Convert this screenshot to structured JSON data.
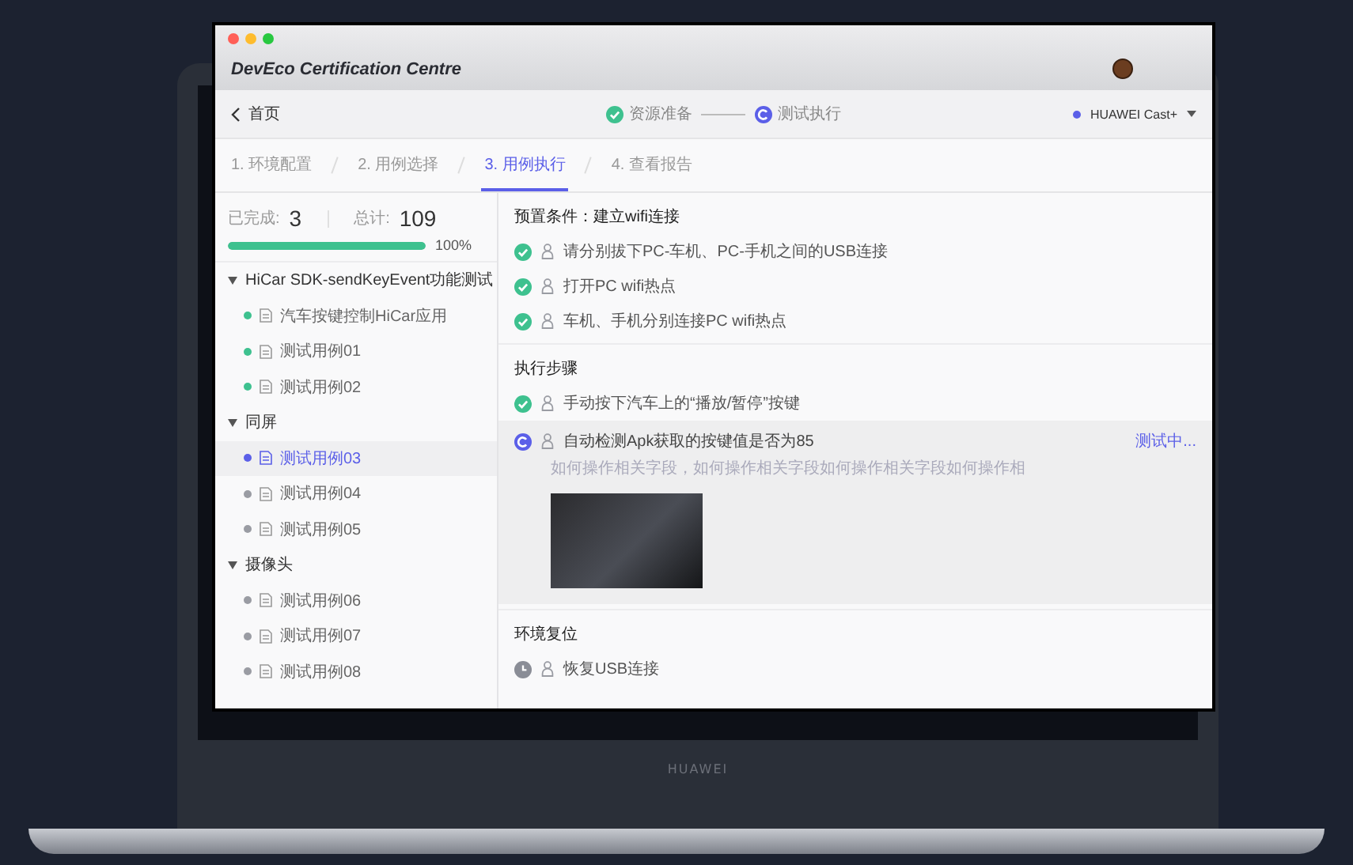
{
  "window": {
    "title": "DevEco Certification Centre"
  },
  "nav": {
    "back_label": "首页",
    "stepper": [
      {
        "label": "资源准备",
        "done": true
      },
      {
        "label": "测试执行",
        "done": false,
        "running": true
      }
    ],
    "device": {
      "name": "HUAWEI Cast+",
      "color": "#5b5fe8"
    }
  },
  "tabs": [
    {
      "label": "1. 环境配置",
      "selected": false
    },
    {
      "label": "2. 用例选择",
      "selected": false
    },
    {
      "label": "3. 用例执行",
      "selected": true
    },
    {
      "label": "4. 查看报告",
      "selected": false
    }
  ],
  "summary": {
    "completed_label": "已完成:",
    "completed": "3",
    "total_label": "总计:",
    "total": "109",
    "level": 1,
    "percent": "100%"
  },
  "tree": [
    {
      "label": "HiCar SDK-sendKeyEvent功能测试",
      "expanded": true,
      "children": [
        {
          "label": "汽车按键控制HiCar应用",
          "color": "#3ec18f",
          "selected": false
        },
        {
          "label": "测试用例01",
          "color": "#3ec18f",
          "selected": false
        },
        {
          "label": "测试用例02",
          "color": "#3ec18f",
          "selected": false
        }
      ]
    },
    {
      "label": "同屏",
      "expanded": true,
      "children": [
        {
          "label": "测试用例03",
          "color": "#5b5fe8",
          "selected": true
        },
        {
          "label": "测试用例04",
          "color": "#9a9ca3",
          "selected": false
        },
        {
          "label": "测试用例05",
          "color": "#9a9ca3",
          "selected": false
        }
      ]
    },
    {
      "label": "摄像头",
      "expanded": true,
      "children": [
        {
          "label": "测试用例06",
          "color": "#9a9ca3",
          "selected": false
        },
        {
          "label": "测试用例07",
          "color": "#9a9ca3",
          "selected": false
        },
        {
          "label": "测试用例08",
          "color": "#9a9ca3",
          "selected": false
        }
      ]
    }
  ],
  "sections": [
    {
      "title": "预置条件：建立wifi连接",
      "items": [
        {
          "text": "请分别拔下PC-车机、PC-手机之间的USB连接",
          "done": true,
          "kind": "step"
        },
        {
          "text": "打开PC wifi热点",
          "done": true,
          "kind": "step"
        },
        {
          "text": "车机、手机分别连接PC wifi热点",
          "done": true,
          "kind": "step"
        }
      ]
    },
    {
      "title": "执行步骤",
      "items": [
        {
          "text": "手动按下汽车上的“播放/暂停”按键",
          "done": true,
          "kind": "step"
        },
        {
          "text": "自动检测Apk获取的按键值是否为85",
          "done": false,
          "running": true,
          "kind": "photo_step",
          "description": "如何操作相关字段，如何操作相关字段如何操作相关字段如何操作相",
          "status_text": "测试中..."
        }
      ]
    },
    {
      "title": "环境复位",
      "items": [
        {
          "text": "恢复USB连接",
          "done": false,
          "running": false,
          "kind": "step"
        }
      ]
    }
  ],
  "laptop": {
    "brand": "HUAWEI"
  }
}
